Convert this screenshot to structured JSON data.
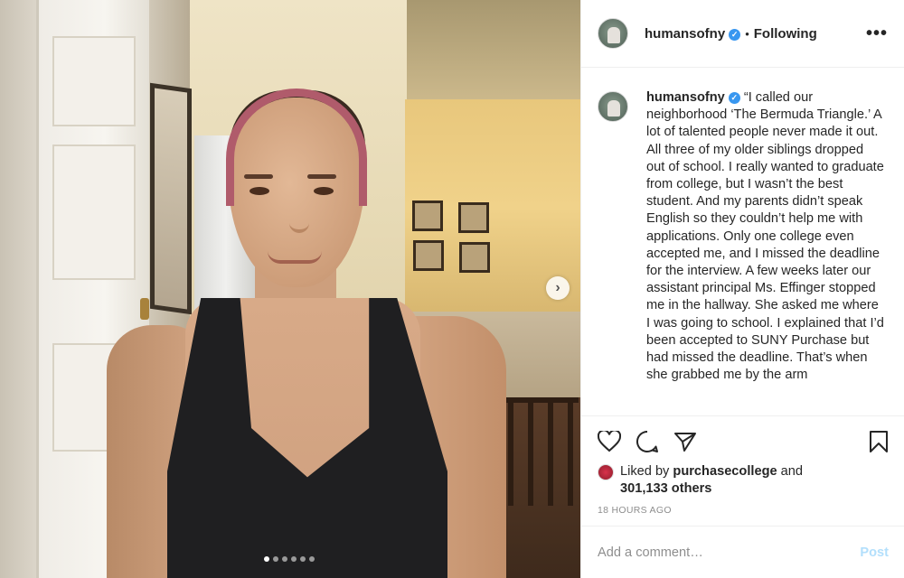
{
  "header": {
    "username": "humansofny",
    "separator": "•",
    "follow_label": "Following",
    "more_label": "•••"
  },
  "caption": {
    "username": "humansofny",
    "text": "“I called our neighborhood ‘The Bermuda Triangle.’ A lot of talented people never made it out. All three of my older siblings dropped out of school. I really wanted to graduate from college, but I wasn’t the best student. And my parents didn’t speak English so they couldn’t help me with applications. Only one college even accepted me, and I missed the deadline for the interview. A few weeks later our assistant principal Ms. Effinger stopped me in the hallway. She asked me where I was going to school. I explained that I’d been accepted to SUNY Purchase but had missed the deadline. That’s when she grabbed me by the arm"
  },
  "icons": {
    "like": "heart-icon",
    "comment": "comment-icon",
    "share": "share-icon",
    "save": "bookmark-icon",
    "verified": "verified-badge-icon",
    "next": "chevron-right-icon"
  },
  "likes": {
    "prefix": "Liked by",
    "user": "purchasecollege",
    "connector": "and",
    "others": "301,133 others"
  },
  "timestamp": "18 HOURS AGO",
  "comment": {
    "placeholder": "Add a comment…",
    "post_label": "Post"
  },
  "carousel": {
    "total_slides": 6,
    "active_slide": 1
  },
  "colors": {
    "verified": "#3897f0",
    "post_disabled": "#b2dffc",
    "muted_text": "#8e8e8e"
  }
}
